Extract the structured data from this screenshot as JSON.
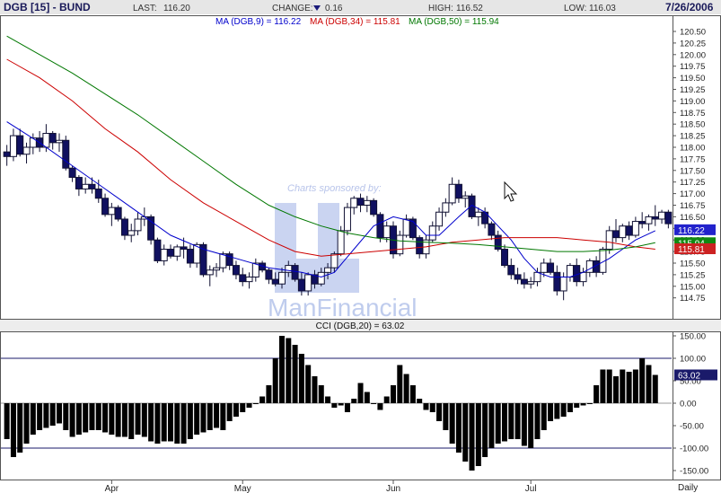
{
  "header": {
    "symbol": "DGB [15] - BUND",
    "last_label": "LAST:",
    "last_value": "116.20",
    "change_label": "CHANGE:",
    "change_value": "0.16",
    "change_direction": "down",
    "high_label": "HIGH:",
    "high_value": "116.52",
    "low_label": "LOW:",
    "low_value": "116.03",
    "date": "7/26/2006"
  },
  "legend": {
    "ma9": "MA (DGB,9) = 116.22",
    "ma34": "MA (DGB,34) = 115.81",
    "ma50": "MA (DGB,50) = 115.94"
  },
  "watermark": {
    "sponsor_text": "Charts sponsored by:",
    "brand_text": "ManFinancial"
  },
  "cci_title": "CCI (DGB,20) = 63.02",
  "x_axis": {
    "labels": [
      "Apr",
      "May",
      "Jun",
      "Jul"
    ],
    "period": "Daily"
  },
  "colors": {
    "up_candle": "#ffffff",
    "down_candle": "#101060",
    "ma9": "#0000cc",
    "ma34": "#cc0000",
    "ma50": "#007700",
    "header_bg": "#e6e6e6",
    "brand_text": "#1a1a5a",
    "watermark": "#8aa0e0"
  },
  "chart_data": [
    {
      "type": "candlestick",
      "title": "DGB [15] - BUND",
      "period": "Daily",
      "ylim": [
        114.5,
        120.6
      ],
      "yticks": [
        "120.50",
        "120.25",
        "120.00",
        "119.75",
        "119.50",
        "119.25",
        "119.00",
        "118.75",
        "118.50",
        "118.25",
        "118.00",
        "117.75",
        "117.50",
        "117.25",
        "117.00",
        "116.75",
        "116.50",
        "116.25",
        "116.00",
        "115.75",
        "115.50",
        "115.25",
        "115.00",
        "114.75"
      ],
      "price_labels": [
        {
          "text": "116.22",
          "value": 116.22,
          "color": "#2222cc"
        },
        {
          "text": "115.94",
          "value": 115.94,
          "color": "#118811"
        },
        {
          "text": "115.81",
          "value": 115.81,
          "color": "#cc2222"
        }
      ],
      "x_axis_labels": [
        {
          "label": "Apr",
          "day": 16
        },
        {
          "label": "May",
          "day": 36
        },
        {
          "label": "Jun",
          "day": 59
        },
        {
          "label": "Jul",
          "day": 80
        }
      ],
      "candles": [
        [
          117.9,
          118.05,
          117.6,
          117.8
        ],
        [
          117.8,
          118.4,
          117.7,
          118.25
        ],
        [
          118.25,
          118.4,
          117.8,
          117.85
        ],
        [
          117.85,
          118.1,
          117.65,
          118.0
        ],
        [
          118.0,
          118.3,
          117.85,
          118.2
        ],
        [
          118.2,
          118.35,
          117.9,
          118.0
        ],
        [
          118.0,
          118.5,
          117.9,
          118.3
        ],
        [
          118.3,
          118.35,
          117.95,
          118.1
        ],
        [
          118.1,
          118.3,
          117.9,
          118.15
        ],
        [
          118.15,
          118.25,
          117.5,
          117.55
        ],
        [
          117.55,
          117.6,
          117.25,
          117.35
        ],
        [
          117.35,
          117.4,
          116.95,
          117.1
        ],
        [
          117.1,
          117.35,
          117.0,
          117.2
        ],
        [
          117.2,
          117.35,
          117.0,
          117.1
        ],
        [
          117.1,
          117.3,
          116.8,
          116.9
        ],
        [
          116.9,
          117.0,
          116.5,
          116.55
        ],
        [
          116.55,
          116.8,
          116.3,
          116.7
        ],
        [
          116.7,
          116.75,
          116.4,
          116.45
        ],
        [
          116.45,
          116.5,
          116.0,
          116.1
        ],
        [
          116.1,
          116.35,
          115.95,
          116.2
        ],
        [
          116.2,
          116.6,
          116.1,
          116.45
        ],
        [
          116.45,
          116.7,
          116.3,
          116.5
        ],
        [
          116.5,
          116.55,
          115.9,
          116.0
        ],
        [
          116.0,
          116.05,
          115.5,
          115.55
        ],
        [
          115.55,
          115.9,
          115.45,
          115.8
        ],
        [
          115.8,
          115.9,
          115.6,
          115.65
        ],
        [
          115.65,
          115.9,
          115.55,
          115.85
        ],
        [
          115.85,
          116.05,
          115.6,
          115.8
        ],
        [
          115.8,
          115.9,
          115.4,
          115.5
        ],
        [
          115.5,
          115.95,
          115.4,
          115.9
        ],
        [
          115.9,
          115.95,
          115.2,
          115.25
        ],
        [
          115.25,
          115.45,
          115.0,
          115.35
        ],
        [
          115.35,
          115.5,
          115.2,
          115.4
        ],
        [
          115.4,
          115.75,
          115.3,
          115.7
        ],
        [
          115.7,
          115.75,
          115.35,
          115.45
        ],
        [
          115.45,
          115.55,
          115.15,
          115.25
        ],
        [
          115.25,
          115.4,
          115.0,
          115.1
        ],
        [
          115.1,
          115.3,
          114.95,
          115.2
        ],
        [
          115.2,
          115.6,
          115.1,
          115.5
        ],
        [
          115.5,
          115.55,
          115.3,
          115.35
        ],
        [
          115.35,
          115.4,
          115.05,
          115.15
        ],
        [
          115.15,
          115.3,
          115.0,
          115.05
        ],
        [
          115.05,
          115.4,
          114.95,
          115.3
        ],
        [
          115.3,
          115.55,
          115.2,
          115.45
        ],
        [
          115.45,
          115.5,
          115.1,
          115.15
        ],
        [
          115.15,
          115.3,
          114.8,
          114.9
        ],
        [
          114.9,
          115.3,
          114.8,
          115.25
        ],
        [
          115.25,
          115.35,
          114.95,
          115.05
        ],
        [
          115.05,
          115.4,
          115.0,
          115.3
        ],
        [
          115.3,
          115.5,
          115.15,
          115.4
        ],
        [
          115.4,
          115.75,
          115.3,
          115.7
        ],
        [
          115.7,
          116.3,
          115.65,
          116.2
        ],
        [
          116.2,
          116.8,
          116.1,
          116.7
        ],
        [
          116.7,
          116.95,
          116.55,
          116.9
        ],
        [
          116.9,
          117.0,
          116.6,
          116.75
        ],
        [
          116.75,
          116.95,
          116.6,
          116.85
        ],
        [
          116.85,
          116.9,
          116.5,
          116.55
        ],
        [
          116.55,
          116.6,
          115.95,
          116.05
        ],
        [
          116.05,
          116.4,
          115.95,
          116.3
        ],
        [
          116.3,
          116.4,
          115.6,
          115.7
        ],
        [
          115.7,
          116.2,
          115.65,
          116.1
        ],
        [
          116.1,
          116.55,
          116.05,
          116.45
        ],
        [
          116.45,
          116.5,
          116.0,
          116.05
        ],
        [
          116.05,
          116.1,
          115.6,
          115.7
        ],
        [
          115.7,
          116.1,
          115.6,
          116.0
        ],
        [
          116.0,
          116.4,
          115.95,
          116.3
        ],
        [
          116.3,
          116.7,
          116.2,
          116.6
        ],
        [
          116.6,
          116.9,
          116.5,
          116.8
        ],
        [
          116.8,
          117.35,
          116.75,
          117.2
        ],
        [
          117.2,
          117.3,
          116.8,
          116.9
        ],
        [
          116.9,
          117.05,
          116.7,
          116.95
        ],
        [
          116.95,
          117.0,
          116.45,
          116.5
        ],
        [
          116.5,
          116.7,
          116.3,
          116.6
        ],
        [
          116.6,
          116.7,
          116.25,
          116.35
        ],
        [
          116.35,
          116.4,
          116.0,
          116.1
        ],
        [
          116.1,
          116.2,
          115.75,
          115.8
        ],
        [
          115.8,
          115.9,
          115.4,
          115.45
        ],
        [
          115.45,
          115.6,
          115.15,
          115.25
        ],
        [
          115.25,
          115.4,
          115.05,
          115.15
        ],
        [
          115.15,
          115.3,
          114.95,
          115.05
        ],
        [
          115.05,
          115.2,
          114.95,
          115.1
        ],
        [
          115.1,
          115.4,
          115.0,
          115.3
        ],
        [
          115.3,
          115.6,
          115.2,
          115.5
        ],
        [
          115.5,
          115.6,
          115.25,
          115.3
        ],
        [
          115.3,
          115.45,
          114.8,
          114.9
        ],
        [
          114.9,
          115.3,
          114.7,
          115.2
        ],
        [
          115.2,
          115.5,
          115.1,
          115.45
        ],
        [
          115.45,
          115.6,
          115.0,
          115.1
        ],
        [
          115.1,
          115.4,
          115.0,
          115.3
        ],
        [
          115.3,
          115.6,
          115.2,
          115.55
        ],
        [
          115.55,
          115.65,
          115.2,
          115.3
        ],
        [
          115.3,
          115.85,
          115.25,
          115.8
        ],
        [
          115.8,
          116.3,
          115.7,
          116.2
        ],
        [
          116.2,
          116.45,
          115.95,
          116.05
        ],
        [
          116.05,
          116.35,
          115.95,
          116.3
        ],
        [
          116.3,
          116.4,
          116.0,
          116.1
        ],
        [
          116.1,
          116.5,
          116.05,
          116.4
        ],
        [
          116.4,
          116.6,
          116.25,
          116.35
        ],
        [
          116.35,
          116.55,
          116.2,
          116.5
        ],
        [
          116.5,
          116.75,
          116.3,
          116.45
        ],
        [
          116.45,
          116.65,
          116.35,
          116.6
        ],
        [
          116.6,
          116.65,
          116.25,
          116.35
        ]
      ],
      "moving_averages": [
        {
          "name": "MA (DGB,9)",
          "color": "#0000cc",
          "points": [
            [
              0,
              118.55
            ],
            [
              5,
              118.1
            ],
            [
              10,
              117.6
            ],
            [
              15,
              117.1
            ],
            [
              20,
              116.6
            ],
            [
              25,
              116.1
            ],
            [
              30,
              115.8
            ],
            [
              35,
              115.6
            ],
            [
              40,
              115.4
            ],
            [
              45,
              115.3
            ],
            [
              48,
              115.2
            ],
            [
              50,
              115.3
            ],
            [
              53,
              115.8
            ],
            [
              56,
              116.3
            ],
            [
              59,
              116.5
            ],
            [
              62,
              116.4
            ],
            [
              64,
              116.1
            ],
            [
              66,
              116.1
            ],
            [
              69,
              116.5
            ],
            [
              71,
              116.75
            ],
            [
              73,
              116.6
            ],
            [
              75,
              116.3
            ],
            [
              77,
              116.0
            ],
            [
              79,
              115.6
            ],
            [
              81,
              115.3
            ],
            [
              83,
              115.2
            ],
            [
              86,
              115.2
            ],
            [
              88,
              115.3
            ],
            [
              90,
              115.45
            ],
            [
              92,
              115.6
            ],
            [
              94,
              115.8
            ],
            [
              96,
              116.0
            ],
            [
              99,
              116.2
            ]
          ]
        },
        {
          "name": "MA (DGB,34)",
          "color": "#cc0000",
          "points": [
            [
              0,
              119.9
            ],
            [
              5,
              119.5
            ],
            [
              10,
              119.0
            ],
            [
              15,
              118.4
            ],
            [
              20,
              117.9
            ],
            [
              25,
              117.3
            ],
            [
              30,
              116.8
            ],
            [
              35,
              116.4
            ],
            [
              40,
              116.0
            ],
            [
              44,
              115.75
            ],
            [
              48,
              115.65
            ],
            [
              52,
              115.7
            ],
            [
              56,
              115.75
            ],
            [
              60,
              115.8
            ],
            [
              64,
              115.85
            ],
            [
              68,
              115.95
            ],
            [
              72,
              116.0
            ],
            [
              76,
              116.05
            ],
            [
              80,
              116.05
            ],
            [
              84,
              116.05
            ],
            [
              88,
              116.0
            ],
            [
              92,
              115.95
            ],
            [
              96,
              115.85
            ],
            [
              99,
              115.8
            ]
          ]
        },
        {
          "name": "MA (DGB,50)",
          "color": "#007700",
          "points": [
            [
              0,
              120.4
            ],
            [
              5,
              120.0
            ],
            [
              10,
              119.6
            ],
            [
              15,
              119.15
            ],
            [
              20,
              118.7
            ],
            [
              25,
              118.2
            ],
            [
              30,
              117.7
            ],
            [
              35,
              117.2
            ],
            [
              40,
              116.75
            ],
            [
              44,
              116.5
            ],
            [
              48,
              116.3
            ],
            [
              52,
              116.15
            ],
            [
              56,
              116.05
            ],
            [
              60,
              115.98
            ],
            [
              64,
              115.95
            ],
            [
              68,
              115.93
            ],
            [
              72,
              115.9
            ],
            [
              76,
              115.85
            ],
            [
              80,
              115.8
            ],
            [
              84,
              115.75
            ],
            [
              88,
              115.75
            ],
            [
              92,
              115.78
            ],
            [
              96,
              115.85
            ],
            [
              99,
              115.94
            ]
          ]
        }
      ]
    },
    {
      "type": "bar",
      "title": "CCI (DGB,20) = 63.02",
      "ylim": [
        -150,
        160
      ],
      "yticks": [
        "150.00",
        "100.00",
        "50.00",
        "0.00",
        "-50.00",
        "-100.00",
        "-150.00"
      ],
      "reference_lines": [
        100,
        -100
      ],
      "last_label": {
        "text": "63.02",
        "value": 63.02
      },
      "values": [
        -80,
        -120,
        -110,
        -90,
        -70,
        -60,
        -55,
        -50,
        -45,
        -60,
        -75,
        -70,
        -65,
        -60,
        -60,
        -65,
        -70,
        -75,
        -75,
        -80,
        -70,
        -75,
        -85,
        -90,
        -85,
        -85,
        -90,
        -90,
        -80,
        -70,
        -65,
        -60,
        -55,
        -60,
        -40,
        -30,
        -20,
        -10,
        0,
        15,
        40,
        100,
        150,
        145,
        130,
        110,
        85,
        60,
        40,
        15,
        -10,
        -5,
        -20,
        10,
        45,
        25,
        0,
        -15,
        15,
        40,
        85,
        65,
        40,
        10,
        -15,
        -20,
        -40,
        -60,
        -90,
        -110,
        -130,
        -150,
        -140,
        -120,
        -100,
        -90,
        -85,
        -80,
        -80,
        -95,
        -100,
        -80,
        -60,
        -40,
        -35,
        -30,
        -20,
        -10,
        -5,
        0,
        40,
        75,
        75,
        60,
        75,
        70,
        75,
        100,
        85,
        63
      ]
    }
  ]
}
